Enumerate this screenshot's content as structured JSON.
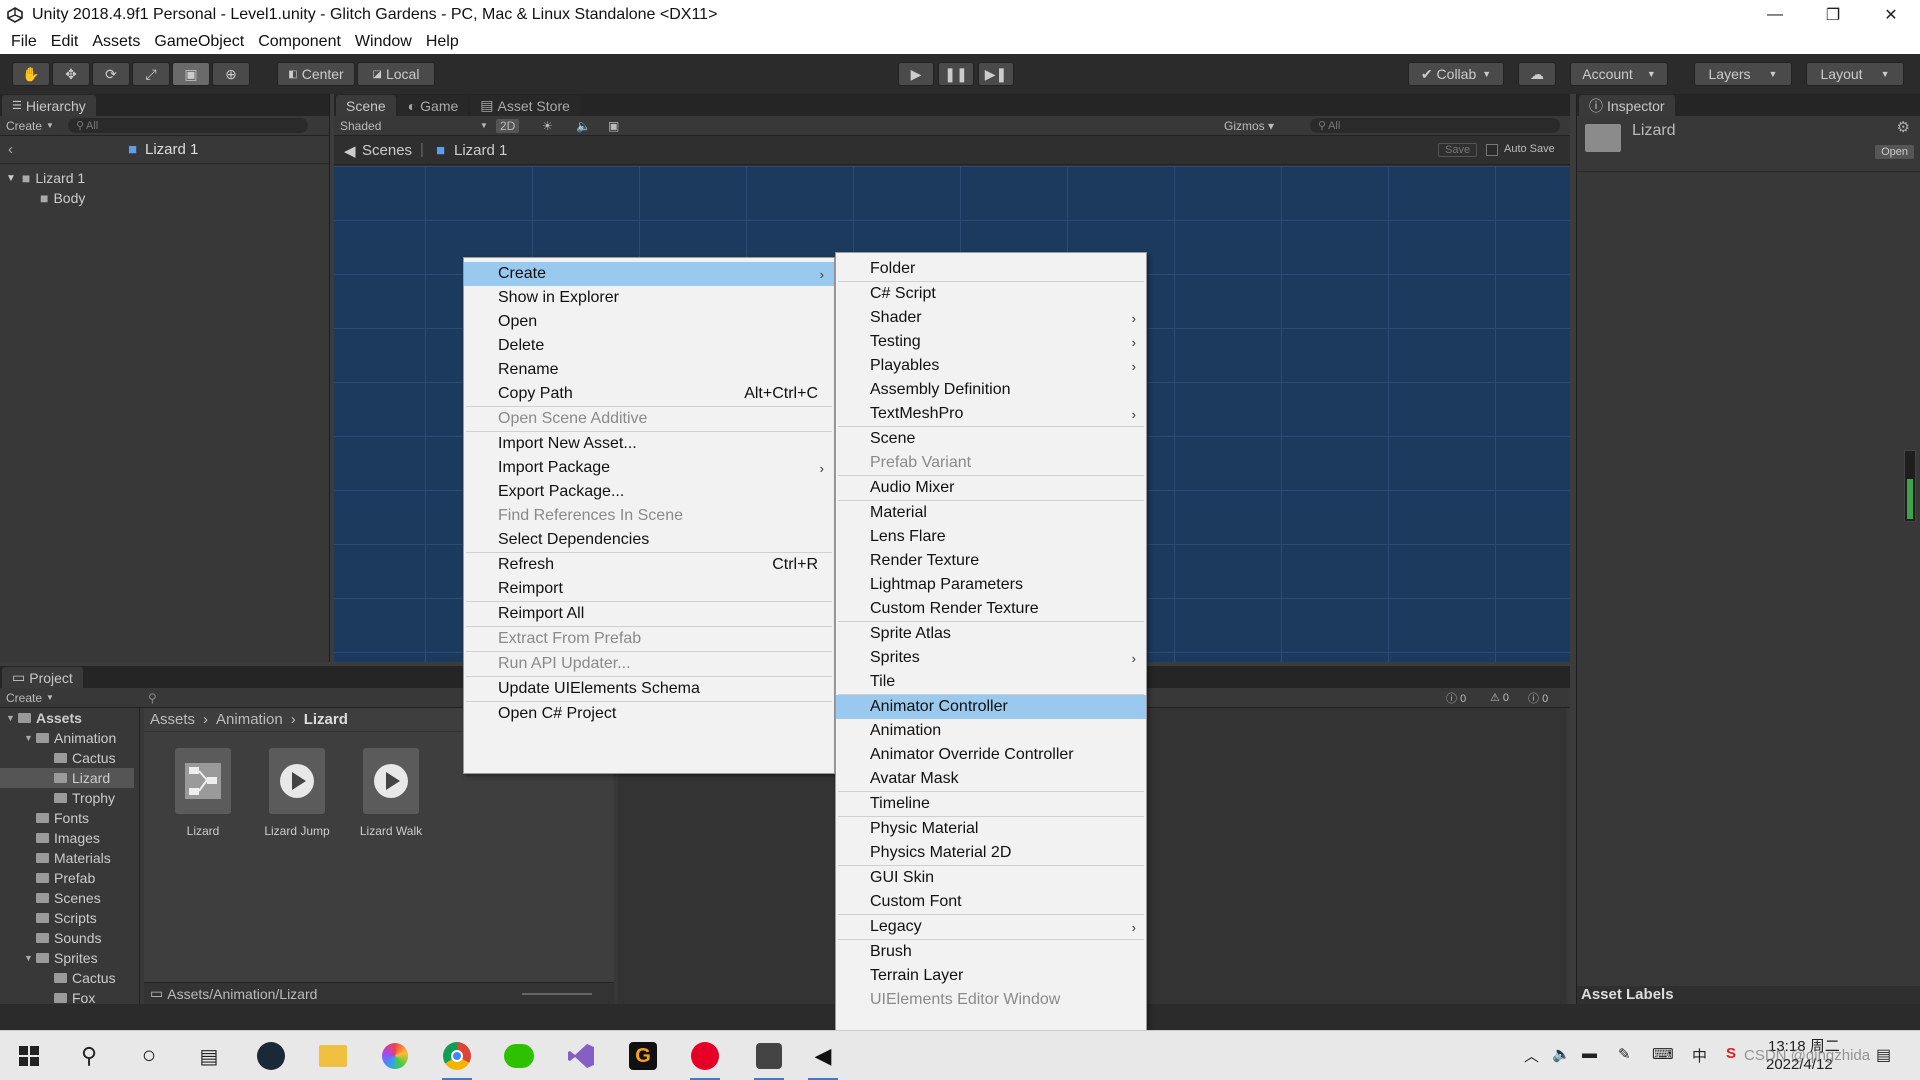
{
  "window": {
    "title": "Unity 2018.4.9f1 Personal - Level1.unity - Glitch Gardens - PC, Mac & Linux Standalone <DX11>",
    "minimize": "—",
    "maximize": "❐",
    "close": "✕"
  },
  "menubar": [
    "File",
    "Edit",
    "Assets",
    "GameObject",
    "Component",
    "Window",
    "Help"
  ],
  "toolbar": {
    "center": "Center",
    "local": "Local",
    "collab": "Collab",
    "account": "Account",
    "layers": "Layers",
    "layout": "Layout"
  },
  "hierarchy": {
    "tab": "Hierarchy",
    "create": "Create",
    "search": "All",
    "breadcrumb": "Lizard 1",
    "items": [
      {
        "label": "Lizard 1"
      },
      {
        "label": "Body"
      }
    ]
  },
  "scene": {
    "tabs": [
      "Scene",
      "Game",
      "Asset Store"
    ],
    "shading": "Shaded",
    "mode_2d": "2D",
    "gizmos": "Gizmos",
    "search": "All",
    "breadcrumb_root": "Scenes",
    "breadcrumb_item": "Lizard 1",
    "save": "Save",
    "auto_save": "Auto Save"
  },
  "inspector": {
    "tab": "Inspector",
    "object_name": "Lizard",
    "open": "Open",
    "asset_labels": "Asset Labels"
  },
  "project": {
    "tab": "Project",
    "create": "Create",
    "tree": [
      {
        "label": "Assets",
        "indent": 0
      },
      {
        "label": "Animation",
        "indent": 1
      },
      {
        "label": "Cactus",
        "indent": 2
      },
      {
        "label": "Lizard",
        "indent": 2
      },
      {
        "label": "Trophy",
        "indent": 2
      },
      {
        "label": "Fonts",
        "indent": 1
      },
      {
        "label": "Images",
        "indent": 1
      },
      {
        "label": "Materials",
        "indent": 1
      },
      {
        "label": "Prefab",
        "indent": 1
      },
      {
        "label": "Scenes",
        "indent": 1
      },
      {
        "label": "Scripts",
        "indent": 1
      },
      {
        "label": "Sounds",
        "indent": 1
      },
      {
        "label": "Sprites",
        "indent": 1
      },
      {
        "label": "Cactus",
        "indent": 2
      },
      {
        "label": "Fox",
        "indent": 2
      }
    ],
    "breadcrumb": [
      "Assets",
      "Animation",
      "Lizard"
    ],
    "assets": [
      {
        "label": "Lizard",
        "icon": "animator-controller-icon"
      },
      {
        "label": "Lizard Jump",
        "icon": "animation-clip-icon"
      },
      {
        "label": "Lizard Walk",
        "icon": "animation-clip-icon"
      }
    ],
    "path": "Assets/Animation/Lizard",
    "console_counts": {
      "messages": "0",
      "warnings": "0",
      "errors": "0"
    }
  },
  "context_menu": {
    "items": [
      {
        "label": "Create",
        "submenu": true,
        "highlight": true
      },
      {
        "label": "Show in Explorer"
      },
      {
        "label": "Open"
      },
      {
        "label": "Delete"
      },
      {
        "label": "Rename"
      },
      {
        "label": "Copy Path",
        "shortcut": "Alt+Ctrl+C"
      },
      {
        "sep": true
      },
      {
        "label": "Open Scene Additive",
        "disabled": true
      },
      {
        "sep": true
      },
      {
        "label": "Import New Asset..."
      },
      {
        "label": "Import Package",
        "submenu": true
      },
      {
        "label": "Export Package..."
      },
      {
        "label": "Find References In Scene",
        "disabled": true
      },
      {
        "label": "Select Dependencies"
      },
      {
        "sep": true
      },
      {
        "label": "Refresh",
        "shortcut": "Ctrl+R"
      },
      {
        "label": "Reimport"
      },
      {
        "sep": true
      },
      {
        "label": "Reimport All"
      },
      {
        "sep": true
      },
      {
        "label": "Extract From Prefab",
        "disabled": true
      },
      {
        "sep": true
      },
      {
        "label": "Run API Updater...",
        "disabled": true
      },
      {
        "sep": true
      },
      {
        "label": "Update UIElements Schema"
      },
      {
        "sep": true
      },
      {
        "label": "Open C# Project"
      }
    ]
  },
  "create_submenu": {
    "items": [
      {
        "label": "Folder"
      },
      {
        "sep": true
      },
      {
        "label": "C# Script"
      },
      {
        "label": "Shader",
        "submenu": true
      },
      {
        "label": "Testing",
        "submenu": true
      },
      {
        "label": "Playables",
        "submenu": true
      },
      {
        "label": "Assembly Definition"
      },
      {
        "label": "TextMeshPro",
        "submenu": true
      },
      {
        "sep": true
      },
      {
        "label": "Scene"
      },
      {
        "label": "Prefab Variant",
        "disabled": true
      },
      {
        "sep": true
      },
      {
        "label": "Audio Mixer"
      },
      {
        "sep": true
      },
      {
        "label": "Material"
      },
      {
        "label": "Lens Flare"
      },
      {
        "label": "Render Texture"
      },
      {
        "label": "Lightmap Parameters"
      },
      {
        "label": "Custom Render Texture"
      },
      {
        "sep": true
      },
      {
        "label": "Sprite Atlas"
      },
      {
        "label": "Sprites",
        "submenu": true
      },
      {
        "label": "Tile"
      },
      {
        "sep": true
      },
      {
        "label": "Animator Controller",
        "highlight": true
      },
      {
        "label": "Animation"
      },
      {
        "label": "Animator Override Controller"
      },
      {
        "label": "Avatar Mask"
      },
      {
        "sep": true
      },
      {
        "label": "Timeline"
      },
      {
        "sep": true
      },
      {
        "label": "Physic Material"
      },
      {
        "label": "Physics Material 2D"
      },
      {
        "sep": true
      },
      {
        "label": "GUI Skin"
      },
      {
        "label": "Custom Font"
      },
      {
        "sep": true
      },
      {
        "label": "Legacy",
        "submenu": true
      },
      {
        "sep": true
      },
      {
        "label": "Brush"
      },
      {
        "label": "Terrain Layer"
      },
      {
        "label": "UIElements Editor Window",
        "disabled": true
      }
    ]
  },
  "taskbar": {
    "clock_time": "13:18 周二",
    "clock_date": "2022/4/12",
    "ime": "中",
    "watermark": "CSDN @qingzhida"
  }
}
